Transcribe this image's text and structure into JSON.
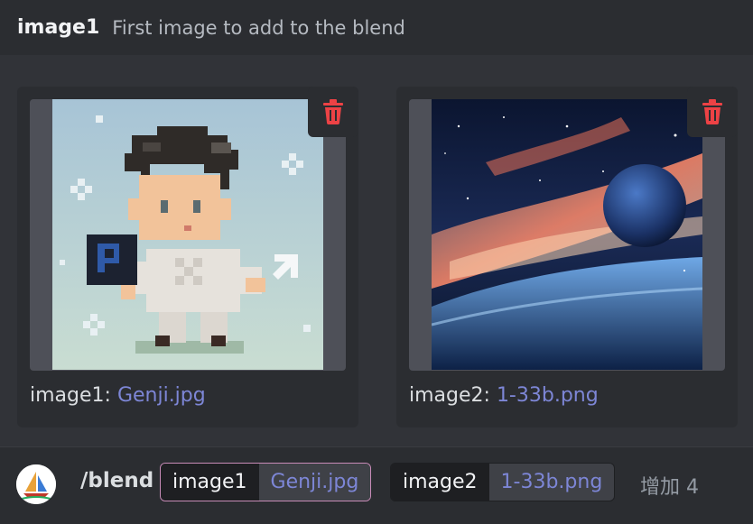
{
  "header": {
    "option_name": "image1",
    "option_description": "First image to add to the blend"
  },
  "attachments": [
    {
      "label_prefix": "image1:",
      "filename": "Genji.jpg",
      "delete_icon": "trash-icon"
    },
    {
      "label_prefix": "image2:",
      "filename": "1-33b.png",
      "delete_icon": "trash-icon"
    }
  ],
  "command_bar": {
    "command": "/blend",
    "options": [
      {
        "key": "image1",
        "value": "Genji.jpg"
      },
      {
        "key": "image2",
        "value": "1-33b.png"
      }
    ],
    "more_label": "增加 4"
  },
  "colors": {
    "accent_link": "#7d86d6",
    "delete_red": "#ed4245",
    "active_option_border": "#c78bb7"
  }
}
